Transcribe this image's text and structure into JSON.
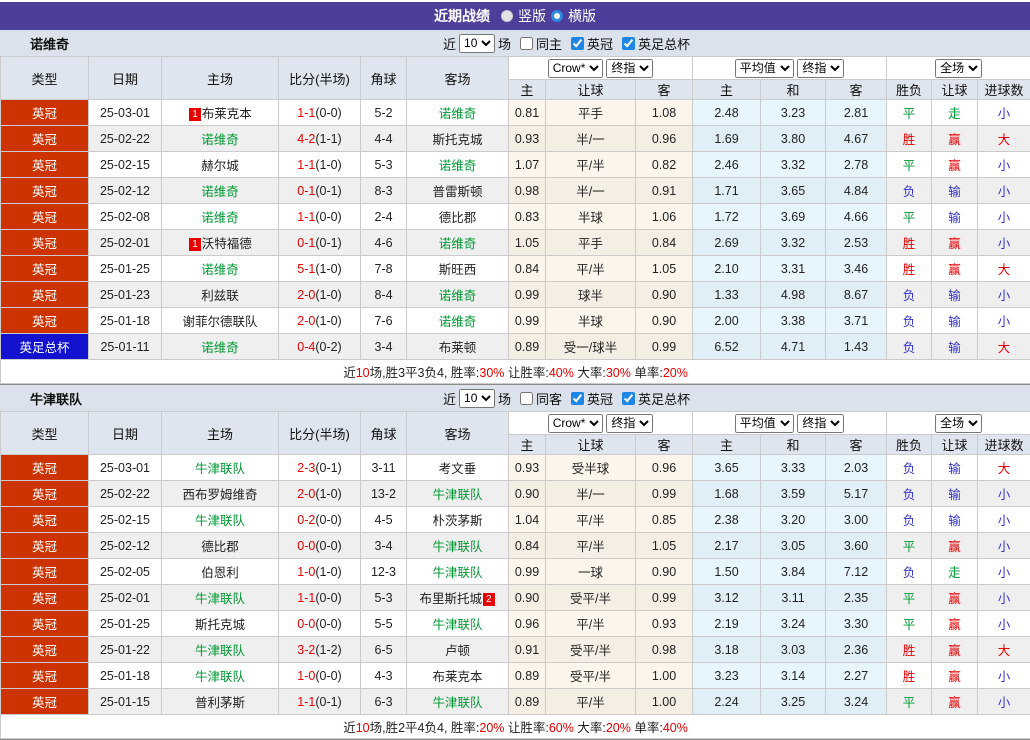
{
  "header": {
    "title": "近期战绩",
    "radio_vertical": "竖版",
    "radio_horizontal": "横版"
  },
  "filters": {
    "near_label": "近",
    "matches_value": "10",
    "games_label": "场",
    "league1": "英冠",
    "league2": "英足总杯"
  },
  "columns": {
    "type": "类型",
    "date": "日期",
    "home": "主场",
    "score": "比分(半场)",
    "corner": "角球",
    "away": "客场",
    "sub_home": "主",
    "sub_handicap": "让球",
    "sub_away": "客",
    "sub_h": "主",
    "sub_draw": "和",
    "sub_a": "客",
    "result": "胜负",
    "handicap_result": "让球",
    "goals": "进球数",
    "select_crow": "Crow*",
    "select_final": "终指",
    "select_avg": "平均值",
    "select_full": "全场"
  },
  "colors": {
    "accent_purple": "#4C3E99",
    "league_badge": "#CC3300",
    "cup_badge": "#1313CF",
    "win_red": "#E60000",
    "draw_green": "#009933",
    "lose_blue": "#3333CC",
    "self_team_green": "#009933"
  },
  "sections": [
    {
      "team": "诺维奇",
      "same_label": "同主",
      "rows": [
        {
          "league": "英冠",
          "cup": false,
          "date": "25-03-01",
          "home": {
            "name": "布莱克本",
            "badge": "1",
            "badge_pos": "before"
          },
          "score_ft": "1-1",
          "score_ht": "(0-0)",
          "corner": "5-2",
          "away": {
            "name": "诺维奇",
            "self": true
          },
          "crow": [
            "0.81",
            "平手",
            "1.08"
          ],
          "avg": [
            "2.48",
            "3.23",
            "2.81"
          ],
          "outcome": [
            "平",
            "走",
            "小"
          ],
          "outcome_colors": [
            "green",
            "green",
            "blue"
          ]
        },
        {
          "league": "英冠",
          "cup": false,
          "date": "25-02-22",
          "home": {
            "name": "诺维奇",
            "self": true
          },
          "score_ft": "4-2",
          "score_ht": "(1-1)",
          "corner": "4-4",
          "away": {
            "name": "斯托克城"
          },
          "crow": [
            "0.93",
            "半/一",
            "0.96"
          ],
          "avg": [
            "1.69",
            "3.80",
            "4.67"
          ],
          "outcome": [
            "胜",
            "赢",
            "大"
          ],
          "outcome_colors": [
            "red",
            "red",
            "red"
          ]
        },
        {
          "league": "英冠",
          "cup": false,
          "date": "25-02-15",
          "home": {
            "name": "赫尔城"
          },
          "score_ft": "1-1",
          "score_ht": "(1-0)",
          "corner": "5-3",
          "away": {
            "name": "诺维奇",
            "self": true
          },
          "crow": [
            "1.07",
            "平/半",
            "0.82"
          ],
          "avg": [
            "2.46",
            "3.32",
            "2.78"
          ],
          "outcome": [
            "平",
            "赢",
            "小"
          ],
          "outcome_colors": [
            "green",
            "red",
            "blue"
          ]
        },
        {
          "league": "英冠",
          "cup": false,
          "date": "25-02-12",
          "home": {
            "name": "诺维奇",
            "self": true
          },
          "score_ft": "0-1",
          "score_ht": "(0-1)",
          "corner": "8-3",
          "away": {
            "name": "普雷斯顿"
          },
          "crow": [
            "0.98",
            "半/一",
            "0.91"
          ],
          "avg": [
            "1.71",
            "3.65",
            "4.84"
          ],
          "outcome": [
            "负",
            "输",
            "小"
          ],
          "outcome_colors": [
            "blue",
            "blue",
            "blue"
          ]
        },
        {
          "league": "英冠",
          "cup": false,
          "date": "25-02-08",
          "home": {
            "name": "诺维奇",
            "self": true
          },
          "score_ft": "1-1",
          "score_ht": "(0-0)",
          "corner": "2-4",
          "away": {
            "name": "德比郡"
          },
          "crow": [
            "0.83",
            "半球",
            "1.06"
          ],
          "avg": [
            "1.72",
            "3.69",
            "4.66"
          ],
          "outcome": [
            "平",
            "输",
            "小"
          ],
          "outcome_colors": [
            "green",
            "blue",
            "blue"
          ]
        },
        {
          "league": "英冠",
          "cup": false,
          "date": "25-02-01",
          "home": {
            "name": "沃特福德",
            "badge": "1",
            "badge_pos": "before"
          },
          "score_ft": "0-1",
          "score_ht": "(0-1)",
          "corner": "4-6",
          "away": {
            "name": "诺维奇",
            "self": true
          },
          "crow": [
            "1.05",
            "平手",
            "0.84"
          ],
          "avg": [
            "2.69",
            "3.32",
            "2.53"
          ],
          "outcome": [
            "胜",
            "赢",
            "小"
          ],
          "outcome_colors": [
            "red",
            "red",
            "blue"
          ]
        },
        {
          "league": "英冠",
          "cup": false,
          "date": "25-01-25",
          "home": {
            "name": "诺维奇",
            "self": true
          },
          "score_ft": "5-1",
          "score_ht": "(1-0)",
          "corner": "7-8",
          "away": {
            "name": "斯旺西"
          },
          "crow": [
            "0.84",
            "平/半",
            "1.05"
          ],
          "avg": [
            "2.10",
            "3.31",
            "3.46"
          ],
          "outcome": [
            "胜",
            "赢",
            "大"
          ],
          "outcome_colors": [
            "red",
            "red",
            "red"
          ]
        },
        {
          "league": "英冠",
          "cup": false,
          "date": "25-01-23",
          "home": {
            "name": "利兹联"
          },
          "score_ft": "2-0",
          "score_ht": "(1-0)",
          "corner": "8-4",
          "away": {
            "name": "诺维奇",
            "self": true
          },
          "crow": [
            "0.99",
            "球半",
            "0.90"
          ],
          "avg": [
            "1.33",
            "4.98",
            "8.67"
          ],
          "outcome": [
            "负",
            "输",
            "小"
          ],
          "outcome_colors": [
            "blue",
            "blue",
            "blue"
          ]
        },
        {
          "league": "英冠",
          "cup": false,
          "date": "25-01-18",
          "home": {
            "name": "谢菲尔德联队"
          },
          "score_ft": "2-0",
          "score_ht": "(1-0)",
          "corner": "7-6",
          "away": {
            "name": "诺维奇",
            "self": true
          },
          "crow": [
            "0.99",
            "半球",
            "0.90"
          ],
          "avg": [
            "2.00",
            "3.38",
            "3.71"
          ],
          "outcome": [
            "负",
            "输",
            "小"
          ],
          "outcome_colors": [
            "blue",
            "blue",
            "blue"
          ]
        },
        {
          "league": "英足总杯",
          "cup": true,
          "date": "25-01-11",
          "home": {
            "name": "诺维奇",
            "self": true
          },
          "score_ft": "0-4",
          "score_ht": "(0-2)",
          "corner": "3-4",
          "away": {
            "name": "布莱顿"
          },
          "crow": [
            "0.89",
            "受一/球半",
            "0.99"
          ],
          "avg": [
            "6.52",
            "4.71",
            "1.43"
          ],
          "outcome": [
            "负",
            "输",
            "大"
          ],
          "outcome_colors": [
            "blue",
            "blue",
            "red"
          ]
        }
      ],
      "summary": {
        "t1": "近",
        "n1": "10",
        "t2": "场,胜3平3负4, 胜率:",
        "n2": "30%",
        "t3": " 让胜率:",
        "n3": "40%",
        "t4": " 大率:",
        "n4": "30%",
        "t5": " 单率:",
        "n5": "20%"
      }
    },
    {
      "team": "牛津联队",
      "same_label": "同客",
      "rows": [
        {
          "league": "英冠",
          "cup": false,
          "date": "25-03-01",
          "home": {
            "name": "牛津联队",
            "self": true
          },
          "score_ft": "2-3",
          "score_ht": "(0-1)",
          "corner": "3-11",
          "away": {
            "name": "考文垂"
          },
          "crow": [
            "0.93",
            "受半球",
            "0.96"
          ],
          "avg": [
            "3.65",
            "3.33",
            "2.03"
          ],
          "outcome": [
            "负",
            "输",
            "大"
          ],
          "outcome_colors": [
            "blue",
            "blue",
            "red"
          ]
        },
        {
          "league": "英冠",
          "cup": false,
          "date": "25-02-22",
          "home": {
            "name": "西布罗姆维奇"
          },
          "score_ft": "2-0",
          "score_ht": "(1-0)",
          "corner": "13-2",
          "away": {
            "name": "牛津联队",
            "self": true
          },
          "crow": [
            "0.90",
            "半/一",
            "0.99"
          ],
          "avg": [
            "1.68",
            "3.59",
            "5.17"
          ],
          "outcome": [
            "负",
            "输",
            "小"
          ],
          "outcome_colors": [
            "blue",
            "blue",
            "blue"
          ]
        },
        {
          "league": "英冠",
          "cup": false,
          "date": "25-02-15",
          "home": {
            "name": "牛津联队",
            "self": true
          },
          "score_ft": "0-2",
          "score_ht": "(0-0)",
          "corner": "4-5",
          "away": {
            "name": "朴茨茅斯"
          },
          "crow": [
            "1.04",
            "平/半",
            "0.85"
          ],
          "avg": [
            "2.38",
            "3.20",
            "3.00"
          ],
          "outcome": [
            "负",
            "输",
            "小"
          ],
          "outcome_colors": [
            "blue",
            "blue",
            "blue"
          ]
        },
        {
          "league": "英冠",
          "cup": false,
          "date": "25-02-12",
          "home": {
            "name": "德比郡"
          },
          "score_ft": "0-0",
          "score_ht": "(0-0)",
          "corner": "3-4",
          "away": {
            "name": "牛津联队",
            "self": true
          },
          "crow": [
            "0.84",
            "平/半",
            "1.05"
          ],
          "avg": [
            "2.17",
            "3.05",
            "3.60"
          ],
          "outcome": [
            "平",
            "赢",
            "小"
          ],
          "outcome_colors": [
            "green",
            "red",
            "blue"
          ]
        },
        {
          "league": "英冠",
          "cup": false,
          "date": "25-02-05",
          "home": {
            "name": "伯恩利"
          },
          "score_ft": "1-0",
          "score_ht": "(1-0)",
          "corner": "12-3",
          "away": {
            "name": "牛津联队",
            "self": true
          },
          "crow": [
            "0.99",
            "一球",
            "0.90"
          ],
          "avg": [
            "1.50",
            "3.84",
            "7.12"
          ],
          "outcome": [
            "负",
            "走",
            "小"
          ],
          "outcome_colors": [
            "blue",
            "green",
            "blue"
          ]
        },
        {
          "league": "英冠",
          "cup": false,
          "date": "25-02-01",
          "home": {
            "name": "牛津联队",
            "self": true
          },
          "score_ft": "1-1",
          "score_ht": "(0-0)",
          "corner": "5-3",
          "away": {
            "name": "布里斯托城",
            "badge": "2",
            "badge_pos": "after"
          },
          "crow": [
            "0.90",
            "受平/半",
            "0.99"
          ],
          "avg": [
            "3.12",
            "3.11",
            "2.35"
          ],
          "outcome": [
            "平",
            "赢",
            "小"
          ],
          "outcome_colors": [
            "green",
            "red",
            "blue"
          ]
        },
        {
          "league": "英冠",
          "cup": false,
          "date": "25-01-25",
          "home": {
            "name": "斯托克城"
          },
          "score_ft": "0-0",
          "score_ht": "(0-0)",
          "corner": "5-5",
          "away": {
            "name": "牛津联队",
            "self": true
          },
          "crow": [
            "0.96",
            "平/半",
            "0.93"
          ],
          "avg": [
            "2.19",
            "3.24",
            "3.30"
          ],
          "outcome": [
            "平",
            "赢",
            "小"
          ],
          "outcome_colors": [
            "green",
            "red",
            "blue"
          ]
        },
        {
          "league": "英冠",
          "cup": false,
          "date": "25-01-22",
          "home": {
            "name": "牛津联队",
            "self": true
          },
          "score_ft": "3-2",
          "score_ht": "(1-2)",
          "corner": "6-5",
          "away": {
            "name": "卢顿"
          },
          "crow": [
            "0.91",
            "受平/半",
            "0.98"
          ],
          "avg": [
            "3.18",
            "3.03",
            "2.36"
          ],
          "outcome": [
            "胜",
            "赢",
            "大"
          ],
          "outcome_colors": [
            "red",
            "red",
            "red"
          ]
        },
        {
          "league": "英冠",
          "cup": false,
          "date": "25-01-18",
          "home": {
            "name": "牛津联队",
            "self": true
          },
          "score_ft": "1-0",
          "score_ht": "(0-0)",
          "corner": "4-3",
          "away": {
            "name": "布莱克本"
          },
          "crow": [
            "0.89",
            "受平/半",
            "1.00"
          ],
          "avg": [
            "3.23",
            "3.14",
            "2.27"
          ],
          "outcome": [
            "胜",
            "赢",
            "小"
          ],
          "outcome_colors": [
            "red",
            "red",
            "blue"
          ]
        },
        {
          "league": "英冠",
          "cup": false,
          "date": "25-01-15",
          "home": {
            "name": "普利茅斯"
          },
          "score_ft": "1-1",
          "score_ht": "(0-1)",
          "corner": "6-3",
          "away": {
            "name": "牛津联队",
            "self": true
          },
          "crow": [
            "0.89",
            "平/半",
            "1.00"
          ],
          "avg": [
            "2.24",
            "3.25",
            "3.24"
          ],
          "outcome": [
            "平",
            "赢",
            "小"
          ],
          "outcome_colors": [
            "green",
            "red",
            "blue"
          ]
        }
      ],
      "summary": {
        "t1": "近",
        "n1": "10",
        "t2": "场,胜2平4负4, 胜率:",
        "n2": "20%",
        "t3": " 让胜率:",
        "n3": "60%",
        "t4": " 大率:",
        "n4": "20%",
        "t5": " 单率:",
        "n5": "40%"
      }
    }
  ]
}
